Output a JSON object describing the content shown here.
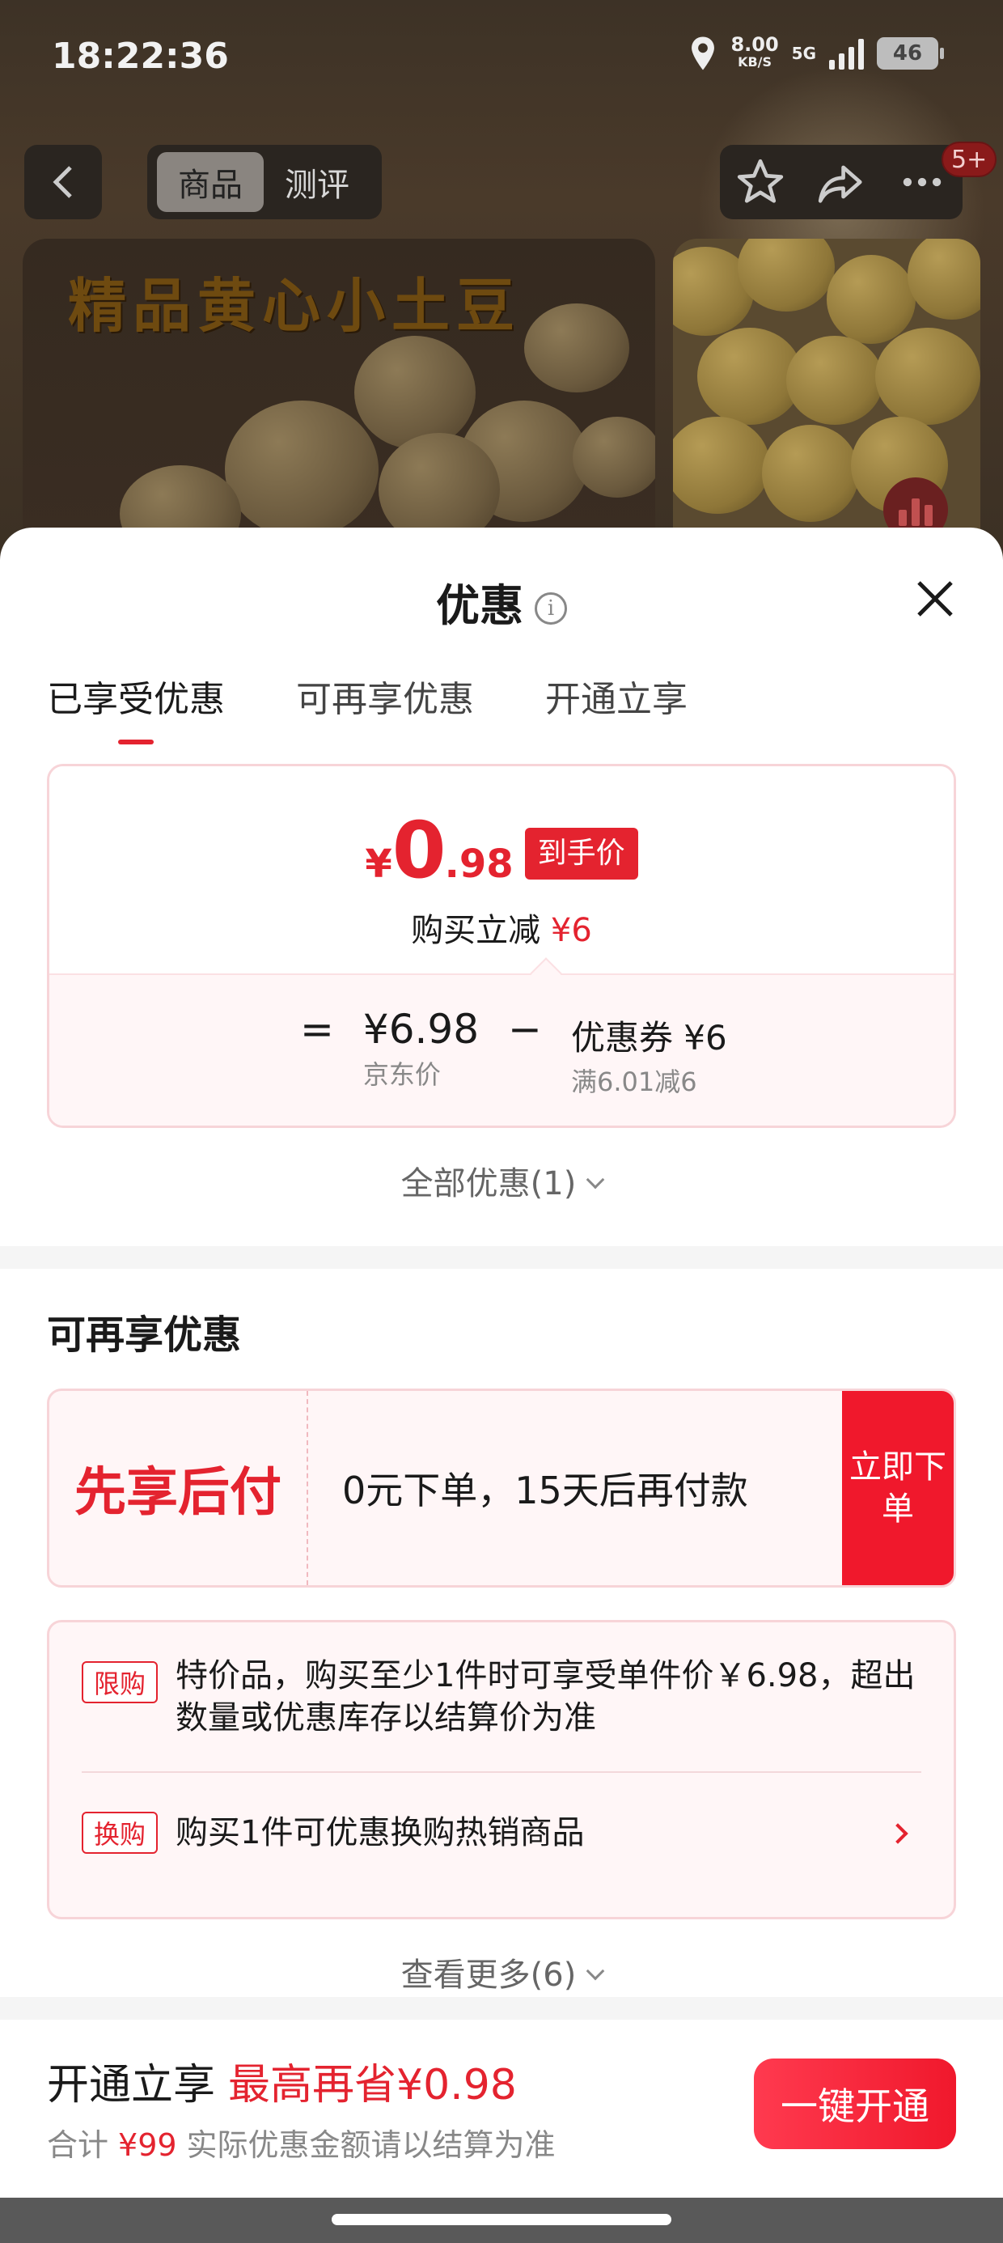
{
  "status_bar": {
    "time": "18:22:36",
    "net_speed": "8.00",
    "net_speed_unit": "KB/S",
    "net_type": "5G",
    "battery": "46"
  },
  "nav": {
    "tab_product": "商品",
    "tab_review": "测评",
    "notification_badge": "5+"
  },
  "banner": {
    "title": "精品黄心小土豆"
  },
  "sheet": {
    "title": "优惠",
    "tabs": [
      "已享受优惠",
      "可再享优惠",
      "开通立享"
    ],
    "active_tab": 0
  },
  "price": {
    "currency": "¥",
    "integer": "0",
    "decimal": ".98",
    "tag": "到手价",
    "reduce_label": "购买立减",
    "reduce_value": "¥6",
    "equals": "=",
    "jd_price": "¥6.98",
    "jd_price_label": "京东价",
    "minus": "−",
    "coupon": "优惠券 ¥6",
    "coupon_rule": "满6.01减6"
  },
  "all_discounts": "全部优惠(1)",
  "more_section": {
    "title": "可再享优惠",
    "bnpl_title": "先享后付",
    "bnpl_desc": "0元下单，15天后再付款",
    "bnpl_button": "立即下单",
    "promos": [
      {
        "tag": "限购",
        "text": "特价品，购买至少1件时可享受单件价￥6.98，超出数量或优惠库存以结算价为准"
      },
      {
        "tag": "换购",
        "text": "购买1件可优惠换购热销商品"
      }
    ],
    "see_more": "查看更多(6)"
  },
  "footer": {
    "title": "开通立享",
    "highlight": "最高再省¥0.98",
    "sub_prefix": "合计",
    "sub_amount": "¥99",
    "sub_suffix": "实际优惠金额请以结算为准",
    "button": "一键开通"
  },
  "colors": {
    "accent": "#e4232f",
    "card_border": "#f7d4d8",
    "card_bg": "#fff6f7"
  }
}
